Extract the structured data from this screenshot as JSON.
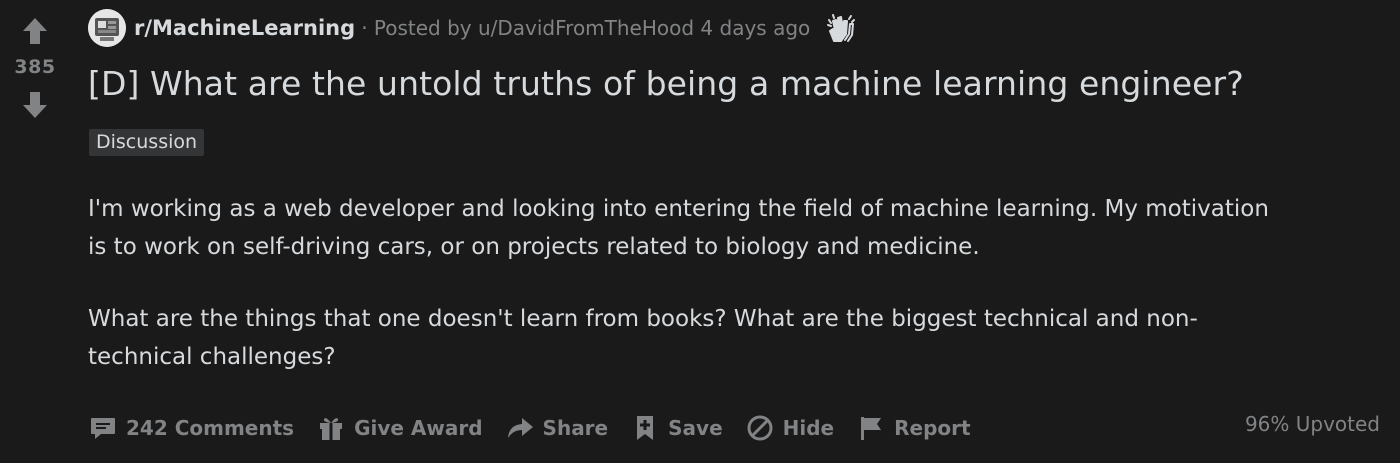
{
  "post": {
    "vote_count": "385",
    "subreddit": "r/MachineLearning",
    "separator": "·",
    "posted_by": "Posted by u/DavidFromTheHood 4 days ago",
    "title": "[D] What are the untold truths of being a machine learning engineer?",
    "flair": "Discussion",
    "body": {
      "paragraph_1": "I'm working as a web developer and looking into entering the field of machine learning. My motivation\nis to work on self-driving cars, or on projects related to biology and medicine.",
      "paragraph_2": "What are the things that one doesn't learn from books? What are the biggest technical and non-\ntechnical challenges?"
    }
  },
  "actions": {
    "comments": "242 Comments",
    "give_award": "Give Award",
    "share": "Share",
    "save": "Save",
    "hide": "Hide",
    "report": "Report"
  },
  "upvoted": "96% Upvoted",
  "icons": {
    "upvote": "arrow-up-icon",
    "downvote": "arrow-down-icon",
    "subreddit_avatar": "subreddit-avatar",
    "award": "clapping-hands-icon",
    "comments": "comment-bubble-icon",
    "give_award": "gift-icon",
    "share": "share-arrow-icon",
    "save": "bookmark-plus-icon",
    "hide": "hide-circle-slash-icon",
    "report": "flag-icon"
  },
  "colors": {
    "background": "#1a1a1b",
    "text": "#d7dadc",
    "muted": "#818384",
    "flair_bg": "#343536"
  }
}
